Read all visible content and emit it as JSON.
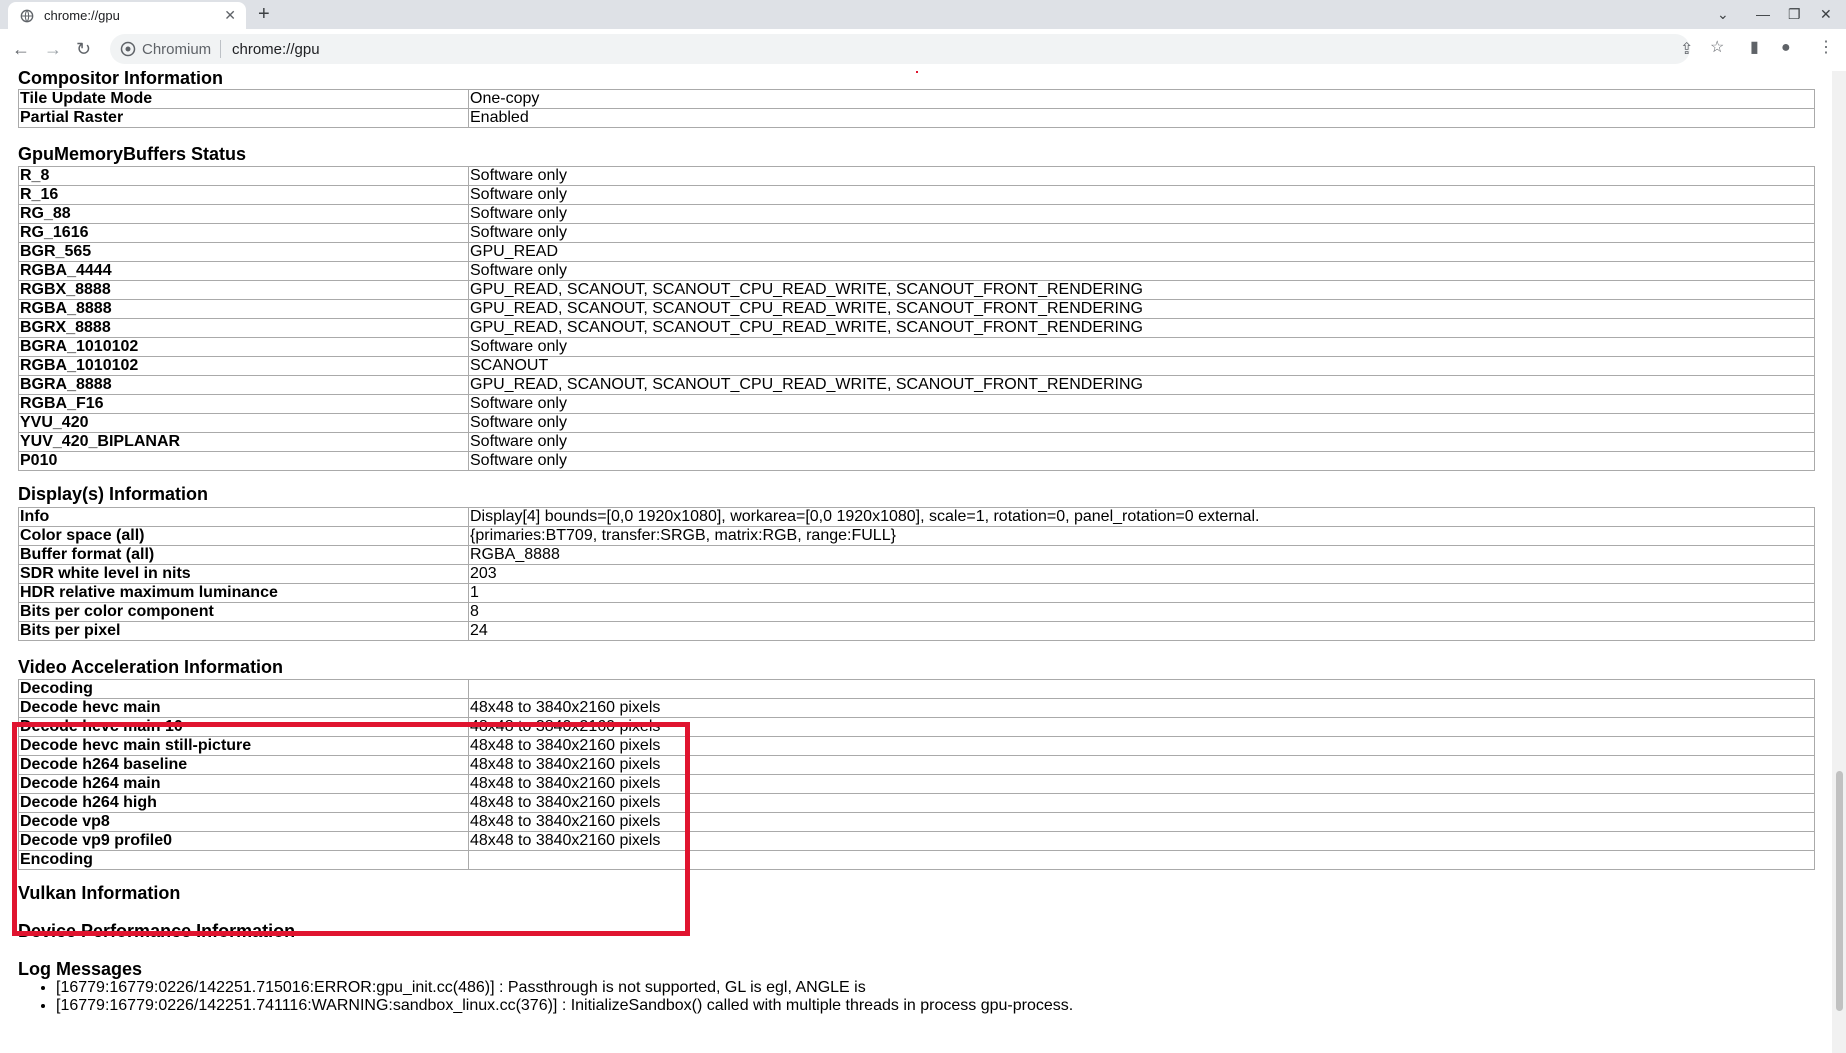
{
  "browser": {
    "tab_title": "chrome://gpu",
    "omnibox_site": "Chromium",
    "omnibox_url": "chrome://gpu",
    "icons": [
      "globe-icon",
      "close-icon",
      "plus-icon",
      "chevron-down-icon",
      "minimize-icon",
      "restore-icon",
      "close-window-icon",
      "back-icon",
      "forward-icon",
      "reload-icon",
      "site-info-icon",
      "share-icon",
      "star-icon",
      "side-panel-icon",
      "profile-icon",
      "kebab-menu-icon"
    ]
  },
  "compositor": {
    "title": "Compositor Information",
    "rows": [
      {
        "k": "Tile Update Mode",
        "v": "One-copy"
      },
      {
        "k": "Partial Raster",
        "v": "Enabled"
      }
    ]
  },
  "gmb": {
    "title": "GpuMemoryBuffers Status",
    "rows": [
      {
        "k": "R_8",
        "v": "Software only"
      },
      {
        "k": "R_16",
        "v": "Software only"
      },
      {
        "k": "RG_88",
        "v": "Software only"
      },
      {
        "k": "RG_1616",
        "v": "Software only"
      },
      {
        "k": "BGR_565",
        "v": "GPU_READ"
      },
      {
        "k": "RGBA_4444",
        "v": "Software only"
      },
      {
        "k": "RGBX_8888",
        "v": "GPU_READ, SCANOUT, SCANOUT_CPU_READ_WRITE, SCANOUT_FRONT_RENDERING"
      },
      {
        "k": "RGBA_8888",
        "v": "GPU_READ, SCANOUT, SCANOUT_CPU_READ_WRITE, SCANOUT_FRONT_RENDERING"
      },
      {
        "k": "BGRX_8888",
        "v": "GPU_READ, SCANOUT, SCANOUT_CPU_READ_WRITE, SCANOUT_FRONT_RENDERING"
      },
      {
        "k": "BGRA_1010102",
        "v": "Software only"
      },
      {
        "k": "RGBA_1010102",
        "v": "SCANOUT"
      },
      {
        "k": "BGRA_8888",
        "v": "GPU_READ, SCANOUT, SCANOUT_CPU_READ_WRITE, SCANOUT_FRONT_RENDERING"
      },
      {
        "k": "RGBA_F16",
        "v": "Software only"
      },
      {
        "k": "YVU_420",
        "v": "Software only"
      },
      {
        "k": "YUV_420_BIPLANAR",
        "v": "Software only"
      },
      {
        "k": "P010",
        "v": "Software only"
      }
    ]
  },
  "display": {
    "title": "Display(s) Information",
    "rows": [
      {
        "k": "Info",
        "v": "Display[4] bounds=[0,0 1920x1080], workarea=[0,0 1920x1080], scale=1, rotation=0, panel_rotation=0 external."
      },
      {
        "k": "Color space (all)",
        "v": "{primaries:BT709, transfer:SRGB, matrix:RGB, range:FULL}"
      },
      {
        "k": "Buffer format (all)",
        "v": "RGBA_8888"
      },
      {
        "k": "SDR white level in nits",
        "v": "203"
      },
      {
        "k": "HDR relative maximum luminance",
        "v": "1"
      },
      {
        "k": "Bits per color component",
        "v": "8"
      },
      {
        "k": "Bits per pixel",
        "v": "24"
      }
    ]
  },
  "video": {
    "title": "Video Acceleration Information",
    "rows": [
      {
        "k": "Decoding",
        "v": ""
      },
      {
        "k": "Decode hevc main",
        "v": "48x48 to 3840x2160 pixels"
      },
      {
        "k": "Decode hevc main 10",
        "v": "48x48 to 3840x2160 pixels"
      },
      {
        "k": "Decode hevc main still-picture",
        "v": "48x48 to 3840x2160 pixels"
      },
      {
        "k": "Decode h264 baseline",
        "v": "48x48 to 3840x2160 pixels"
      },
      {
        "k": "Decode h264 main",
        "v": "48x48 to 3840x2160 pixels"
      },
      {
        "k": "Decode h264 high",
        "v": "48x48 to 3840x2160 pixels"
      },
      {
        "k": "Decode vp8",
        "v": "48x48 to 3840x2160 pixels"
      },
      {
        "k": "Decode vp9 profile0",
        "v": "48x48 to 3840x2160 pixels"
      },
      {
        "k": "Encoding",
        "v": ""
      }
    ]
  },
  "vulkan": {
    "title": "Vulkan Information"
  },
  "device_perf": {
    "title": "Device Performance Information"
  },
  "log": {
    "title": "Log Messages",
    "items": [
      "[16779:16779:0226/142251.715016:ERROR:gpu_init.cc(486)] : Passthrough is not supported, GL is egl, ANGLE is",
      "[16779:16779:0226/142251.741116:WARNING:sandbox_linux.cc(376)] : InitializeSandbox() called with multiple threads in process gpu-process."
    ]
  },
  "colors": {
    "highlight": "#e0142f",
    "tabstrip": "#dee1e6",
    "omnibox": "#f1f3f4"
  }
}
